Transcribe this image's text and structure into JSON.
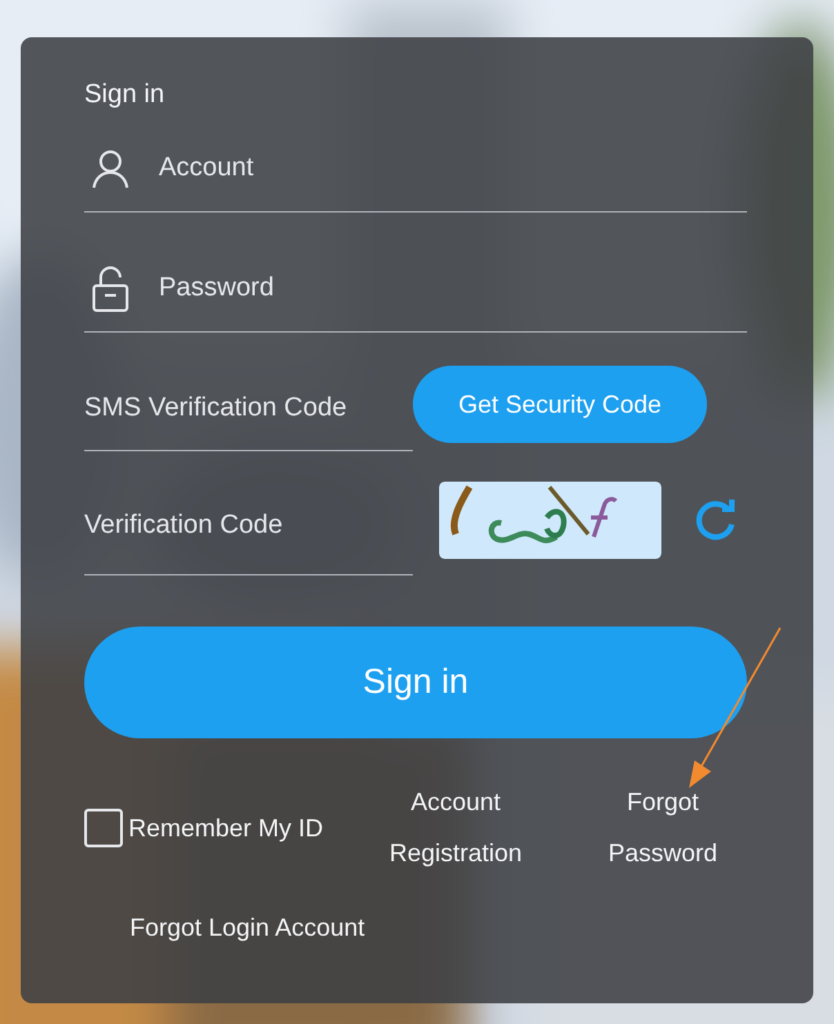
{
  "title": "Sign in",
  "fields": [
    {
      "kind": "account",
      "placeholder": "Account"
    },
    {
      "kind": "password",
      "placeholder": "Password"
    }
  ],
  "sms": {
    "placeholder": "SMS Verification Code",
    "button": "Get Security Code"
  },
  "verification": {
    "placeholder": "Verification Code"
  },
  "submit": "Sign in",
  "remember": {
    "label": "Remember My ID",
    "checked": false
  },
  "links": [
    "Account Registration",
    "Forgot Password"
  ],
  "forgot_account": "Forgot Login Account"
}
